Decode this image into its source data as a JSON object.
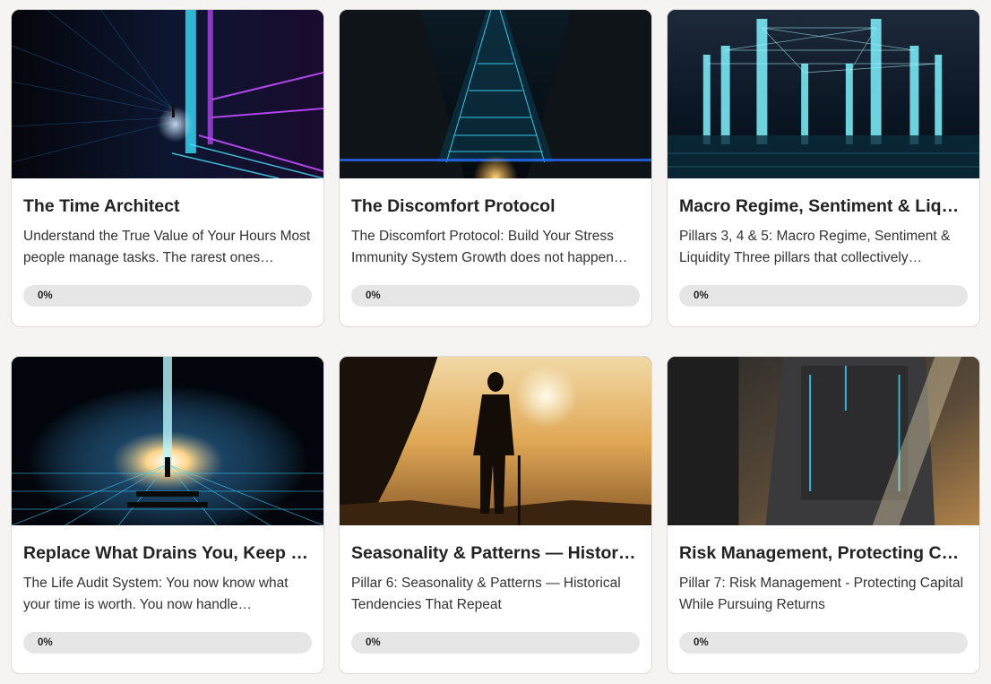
{
  "courses": [
    {
      "title": "The Time Architect",
      "description": "Understand the True Value of Your Hours Most people manage tasks. The rarest ones…",
      "progress_label": "0%",
      "progress": 0,
      "image": "digital-grid-time-corridor-image"
    },
    {
      "title": "The Discomfort Protocol",
      "description": "The Discomfort Protocol: Build Your Stress Immunity System Growth does not happen…",
      "progress_label": "0%",
      "progress": 0,
      "image": "neon-grid-path-image"
    },
    {
      "title": "Macro Regime, Sentiment & Liqui…",
      "description": "Pillars 3, 4 & 5: Macro Regime, Sentiment & Liquidity Three pillars that collectively…",
      "progress_label": "0%",
      "progress": 0,
      "image": "glowing-pillars-network-image"
    },
    {
      "title": "Replace What Drains You, Keep W…",
      "description": "The Life Audit System: You now know what your time is worth. You now handle…",
      "progress_label": "0%",
      "progress": 0,
      "image": "energy-burst-figure-image"
    },
    {
      "title": "Seasonality & Patterns — History …",
      "description": "Pillar 6: Seasonality & Patterns — Historical Tendencies That Repeat",
      "progress_label": "0%",
      "progress": 0,
      "image": "hiker-sunset-silhouette-image"
    },
    {
      "title": "Risk Management, Protecting Cap…",
      "description": "Pillar 7: Risk Management - Protecting Capital While Pursuing Returns",
      "progress_label": "0%",
      "progress": 0,
      "image": "armored-vault-orb-image"
    }
  ]
}
